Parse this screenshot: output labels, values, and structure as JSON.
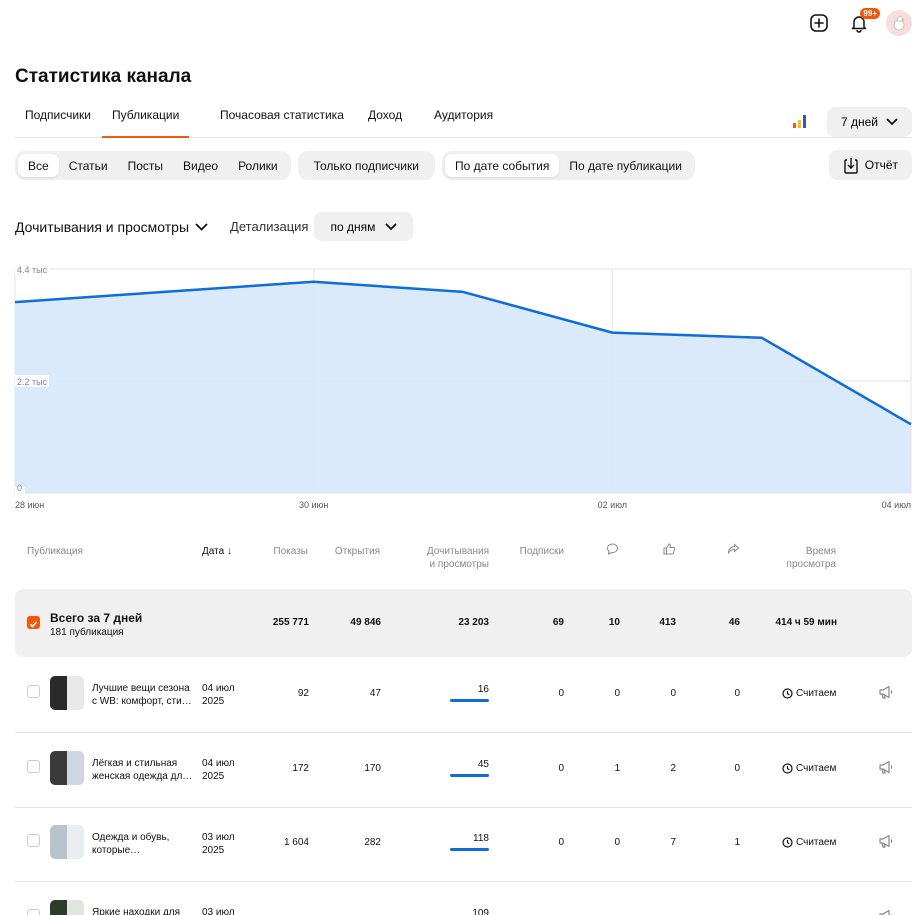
{
  "topbar": {
    "notifications_badge": "99+"
  },
  "page": {
    "title": "Статистика канала"
  },
  "tabs": [
    {
      "label": "Подписчики"
    },
    {
      "label": "Публикации"
    },
    {
      "label": "Почасовая статистика"
    },
    {
      "label": "Доход"
    },
    {
      "label": "Аудитория"
    }
  ],
  "period": {
    "label": "7 дней"
  },
  "filters": {
    "types": [
      "Все",
      "Статьи",
      "Посты",
      "Видео",
      "Ролики"
    ],
    "subscribers_only": "Только подписчики",
    "date_modes": [
      "По дате события",
      "По дате публикации"
    ],
    "report": "Отчёт"
  },
  "metric": {
    "label": "Дочитывания и просмотры",
    "detail_label": "Детализация",
    "detail_value": "по дням"
  },
  "colors": {
    "accent": "#f2580c",
    "line": "#0f6dd7",
    "area": "#d6e8fb"
  },
  "chart_data": {
    "type": "area",
    "x": [
      "28 июн",
      "29 июн",
      "30 июн",
      "01 июл",
      "02 июл",
      "03 июл",
      "04 июл"
    ],
    "x_tick_labels": [
      "28 июн",
      "30 июн",
      "02 июл",
      "04 июл"
    ],
    "y_tick_labels": [
      "4.4 тыс",
      "2.2 тыс",
      "0"
    ],
    "ylim": [
      0,
      4400
    ],
    "series": [
      {
        "values": [
          3750,
          3950,
          4150,
          3950,
          3150,
          3050,
          1350
        ]
      }
    ],
    "grid": true
  },
  "table": {
    "headers": {
      "publication": "Публикация",
      "date": "Дата",
      "impressions": "Показы",
      "opens": "Открытия",
      "reads_line1": "Дочитывания",
      "reads_line2": "и просмотры",
      "subs": "Подписки",
      "time_line1": "Время",
      "time_line2": "просмотра"
    },
    "total": {
      "title": "Всего за 7 дней",
      "subtitle": "181 публикация",
      "impressions": "255 771",
      "opens": "49 846",
      "reads": "23 203",
      "subs": "69",
      "comments": "10",
      "likes": "413",
      "reposts": "46",
      "time": "414 ч 59 мин"
    },
    "rows": [
      {
        "title_1": "Лучшие вещи сезона",
        "title_2": "с WB: комфорт, сти…",
        "date_1": "04 июл",
        "date_2": "2025",
        "impressions": "92",
        "opens": "47",
        "reads": "16",
        "subs": "0",
        "comments": "0",
        "likes": "0",
        "reposts": "0",
        "time": "Считаем"
      },
      {
        "title_1": "Лёгкая и стильная",
        "title_2": "женская одежда дл…",
        "date_1": "04 июл",
        "date_2": "2025",
        "impressions": "172",
        "opens": "170",
        "reads": "45",
        "subs": "0",
        "comments": "1",
        "likes": "2",
        "reposts": "0",
        "time": "Считаем"
      },
      {
        "title_1": "Одежда и обувь,",
        "title_2": "которые…",
        "date_1": "03 июл",
        "date_2": "2025",
        "impressions": "1 604",
        "opens": "282",
        "reads": "118",
        "subs": "0",
        "comments": "0",
        "likes": "7",
        "reposts": "1",
        "time": "Считаем"
      },
      {
        "title_1": "Яркие находки для",
        "title_2": "",
        "date_1": "03 июл",
        "date_2": "",
        "impressions": "",
        "opens": "",
        "reads": "109",
        "subs": "",
        "comments": "",
        "likes": "",
        "reposts": "",
        "time": ""
      }
    ]
  }
}
